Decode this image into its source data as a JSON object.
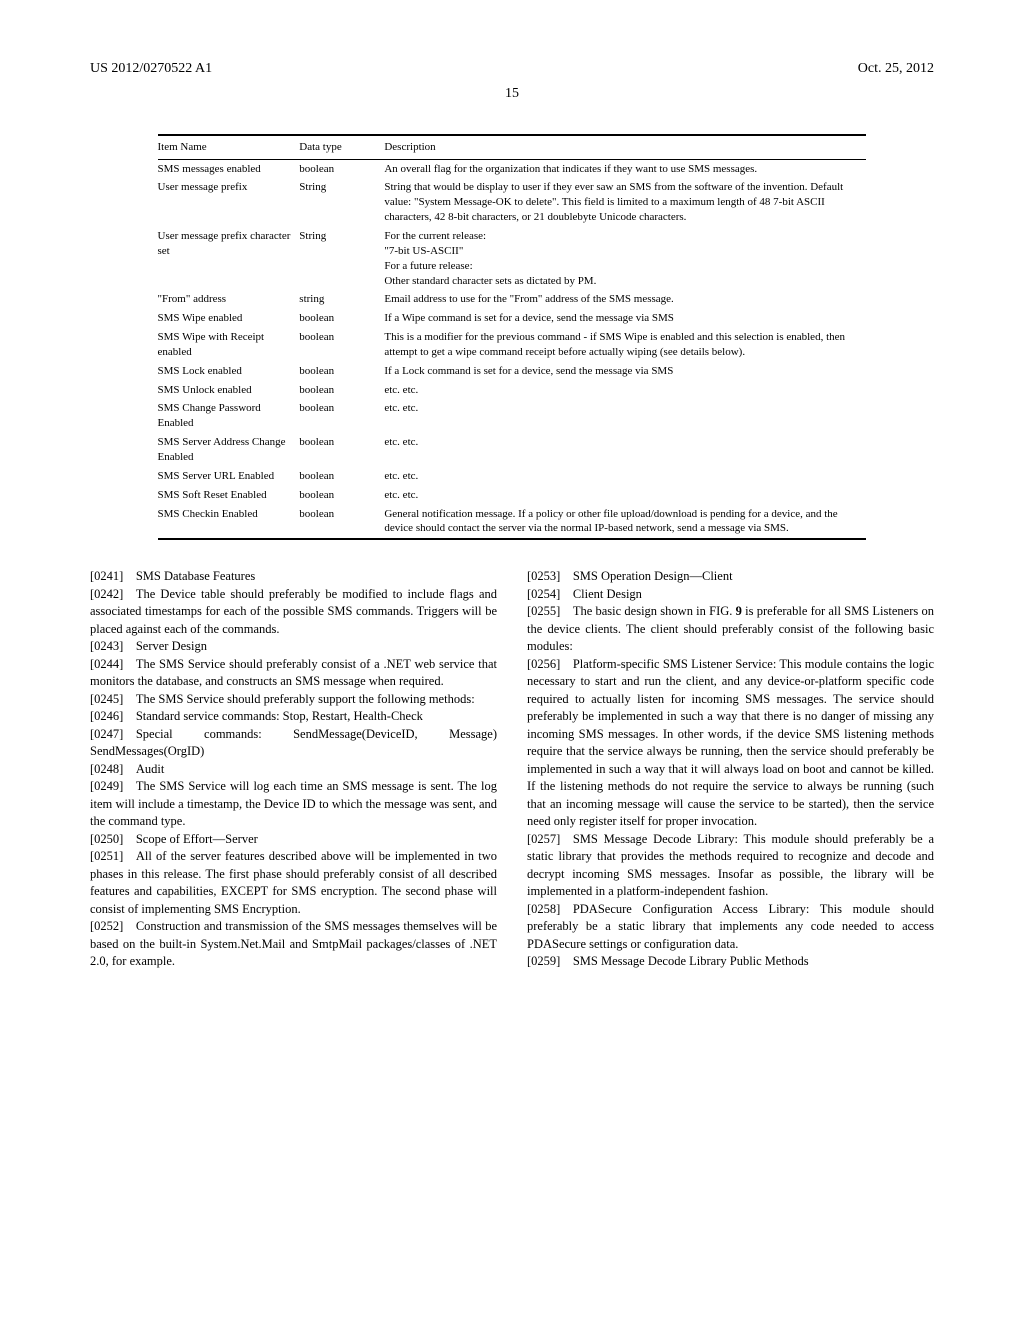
{
  "header": {
    "pub_number": "US 2012/0270522 A1",
    "pub_date": "Oct. 25, 2012",
    "page_number": "15"
  },
  "table": {
    "headers": {
      "c1": "Item Name",
      "c2": "Data type",
      "c3": "Description"
    },
    "rows": [
      {
        "name": "SMS messages enabled",
        "type": "boolean",
        "desc": "An overall flag for the organization that indicates if they want to use SMS messages."
      },
      {
        "name": "User message prefix",
        "type": "String",
        "desc": "String that would be display to user if they ever saw an SMS from the software of the invention. Default value: \"System Message-OK to delete\". This field is limited to a maximum length of 48 7-bit ASCII characters, 42 8-bit characters, or 21 doublebyte Unicode characters."
      },
      {
        "name": "User message prefix character set",
        "type": "String",
        "desc": "For the current release:\n\"7-bit US-ASCII\"\nFor a future release:\nOther standard character sets as dictated by PM."
      },
      {
        "name": "\"From\" address",
        "type": "string",
        "desc": "Email address to use for the \"From\" address of the SMS message."
      },
      {
        "name": "SMS Wipe enabled",
        "type": "boolean",
        "desc": "If a Wipe command is set for a device, send the message via SMS"
      },
      {
        "name": "SMS Wipe with Receipt enabled",
        "type": "boolean",
        "desc": "This is a modifier for the previous command - if SMS Wipe is enabled and this selection is enabled, then attempt to get a wipe command receipt before actually wiping (see details below)."
      },
      {
        "name": "SMS Lock enabled",
        "type": "boolean",
        "desc": "If a Lock command is set for a device, send the message via SMS"
      },
      {
        "name": "SMS Unlock enabled",
        "type": "boolean",
        "desc": "etc. etc."
      },
      {
        "name": "SMS Change Password Enabled",
        "type": "boolean",
        "desc": "etc. etc."
      },
      {
        "name": "SMS Server Address Change Enabled",
        "type": "boolean",
        "desc": "etc. etc."
      },
      {
        "name": "SMS Server URL Enabled",
        "type": "boolean",
        "desc": "etc. etc."
      },
      {
        "name": "SMS Soft Reset Enabled",
        "type": "boolean",
        "desc": "etc. etc."
      },
      {
        "name": "SMS Checkin Enabled",
        "type": "boolean",
        "desc": "General notification message. If a policy or other file upload/download is pending for a device, and the device should contact the server via the normal IP-based network, send a message via SMS."
      }
    ]
  },
  "left_col": [
    {
      "num": "[0241]",
      "text": "SMS Database Features"
    },
    {
      "num": "[0242]",
      "text": "The Device table should preferably be modified to include flags and associated timestamps for each of the possible SMS commands. Triggers will be placed against each of the commands."
    },
    {
      "num": "[0243]",
      "text": "Server Design"
    },
    {
      "num": "[0244]",
      "text": "The SMS Service should preferably consist of a .NET web service that monitors the database, and constructs an SMS message when required."
    },
    {
      "num": "[0245]",
      "text": "The SMS Service should preferably support the following methods:"
    },
    {
      "num": "[0246]",
      "text": "Standard service commands: Stop, Restart, Health-Check"
    },
    {
      "num": "[0247]",
      "text": "Special commands: SendMessage(DeviceID, Message) SendMessages(OrgID)"
    },
    {
      "num": "[0248]",
      "text": "Audit"
    },
    {
      "num": "[0249]",
      "text": "The SMS Service will log each time an SMS message is sent. The log item will include a timestamp, the Device ID to which the message was sent, and the command type."
    },
    {
      "num": "[0250]",
      "text": "Scope of Effort—Server"
    },
    {
      "num": "[0251]",
      "text": "All of the server features described above will be implemented in two phases in this release. The first phase should preferably consist of all described features and capabilities, EXCEPT for SMS encryption. The second phase will consist of implementing SMS Encryption."
    },
    {
      "num": "[0252]",
      "text": "Construction and transmission of the SMS messages themselves will be based on the built-in System.Net.Mail and SmtpMail packages/classes of .NET 2.0, for example."
    }
  ],
  "right_col": [
    {
      "num": "[0253]",
      "text": "SMS Operation Design—Client"
    },
    {
      "num": "[0254]",
      "text": "Client Design"
    },
    {
      "num": "[0255]",
      "text": "The basic design shown in FIG. 9 is preferable for all SMS Listeners on the device clients. The client should preferably consist of the following basic modules:"
    },
    {
      "num": "[0256]",
      "text": "Platform-specific SMS Listener Service: This module contains the logic necessary to start and run the client, and any device-or-platform specific code required to actually listen for incoming SMS messages. The service should preferably be implemented in such a way that there is no danger of missing any incoming SMS messages. In other words, if the device SMS listening methods require that the service always be running, then the service should preferably be implemented in such a way that it will always load on boot and cannot be killed. If the listening methods do not require the service to always be running (such that an incoming message will cause the service to be started), then the service need only register itself for proper invocation."
    },
    {
      "num": "[0257]",
      "text": "SMS Message Decode Library: This module should preferably be a static library that provides the methods required to recognize and decode and decrypt incoming SMS messages. Insofar as possible, the library will be implemented in a platform-independent fashion."
    },
    {
      "num": "[0258]",
      "text": "PDASecure Configuration Access Library: This module should preferably be a static library that implements any code needed to access PDASecure settings or configuration data."
    },
    {
      "num": "[0259]",
      "text": "SMS Message Decode Library Public Methods"
    }
  ],
  "bold_ref": "9"
}
